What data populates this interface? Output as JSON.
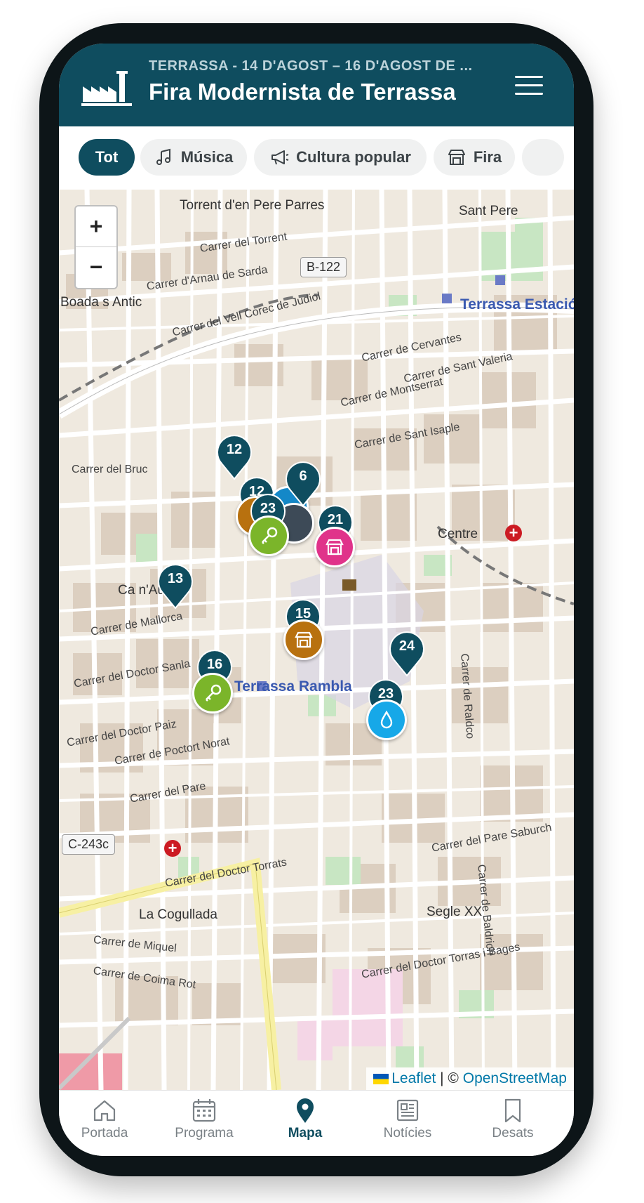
{
  "header": {
    "subtitle": "TERRASSA - 14 D'AGOST – 16 D'AGOST DE ...",
    "title": "Fira Modernista de Terrassa"
  },
  "filters": [
    {
      "label": "Tot",
      "icon": "none",
      "active": true
    },
    {
      "label": "Música",
      "icon": "music-note-icon",
      "active": false
    },
    {
      "label": "Cultura popular",
      "icon": "megaphone-icon",
      "active": false
    },
    {
      "label": "Fira",
      "icon": "market-stall-icon",
      "active": false
    }
  ],
  "map": {
    "zoom_in": "+",
    "zoom_out": "−",
    "places": [
      "Torrent d'en Pere Parres",
      "Sant Pere",
      "Boada s Antic",
      "Centre",
      "Ca n'Aurell",
      "La Cogullada",
      "Segle XX"
    ],
    "stations": [
      "Terrassa Estació del Nord",
      "Terrassa Rambla"
    ],
    "roads": [
      "B-122",
      "C-243c"
    ],
    "streets": [
      "Carrer del Torrent",
      "Carrer d'Arnau de Sarda",
      "Carrer del Vell Corec de Judiol",
      "Carrer de Cervantes",
      "Carrer de Montserrat",
      "Carrer de Sant Valeria",
      "Carrer de Sant Isaple",
      "Carrer del Bruc",
      "Carrer de Mallorca",
      "Carrer del Doctor Sanla",
      "Carrer del Doctor Paiz",
      "Carrer de Poctort Norat",
      "Carrer del Pare",
      "Carrer del Pare Saburch",
      "Carrer del Doctor Torrats",
      "Carrer de Miquel",
      "Carrer de Coima Rot",
      "Carrer del Doctor Torras i Bages",
      "Carrer de Baldrich",
      "Carrer de Raldco"
    ],
    "cluster_markers": [
      "12",
      "12",
      "6",
      "23",
      "21",
      "13",
      "15",
      "24",
      "16",
      "23"
    ],
    "attribution": {
      "leaflet": "Leaflet",
      "separator": " | © ",
      "osm": "OpenStreetMap"
    },
    "colors": {
      "cluster": "#0f4d5f",
      "music": "#7bb52a",
      "culture": "#b8710f",
      "fair": "#e0338a",
      "water": "#16a8e8"
    }
  },
  "tabs": [
    {
      "label": "Portada",
      "icon": "home-icon",
      "active": false
    },
    {
      "label": "Programa",
      "icon": "calendar-icon",
      "active": false
    },
    {
      "label": "Mapa",
      "icon": "map-pin-icon",
      "active": true
    },
    {
      "label": "Notícies",
      "icon": "newspaper-icon",
      "active": false
    },
    {
      "label": "Desats",
      "icon": "bookmark-icon",
      "active": false
    }
  ]
}
